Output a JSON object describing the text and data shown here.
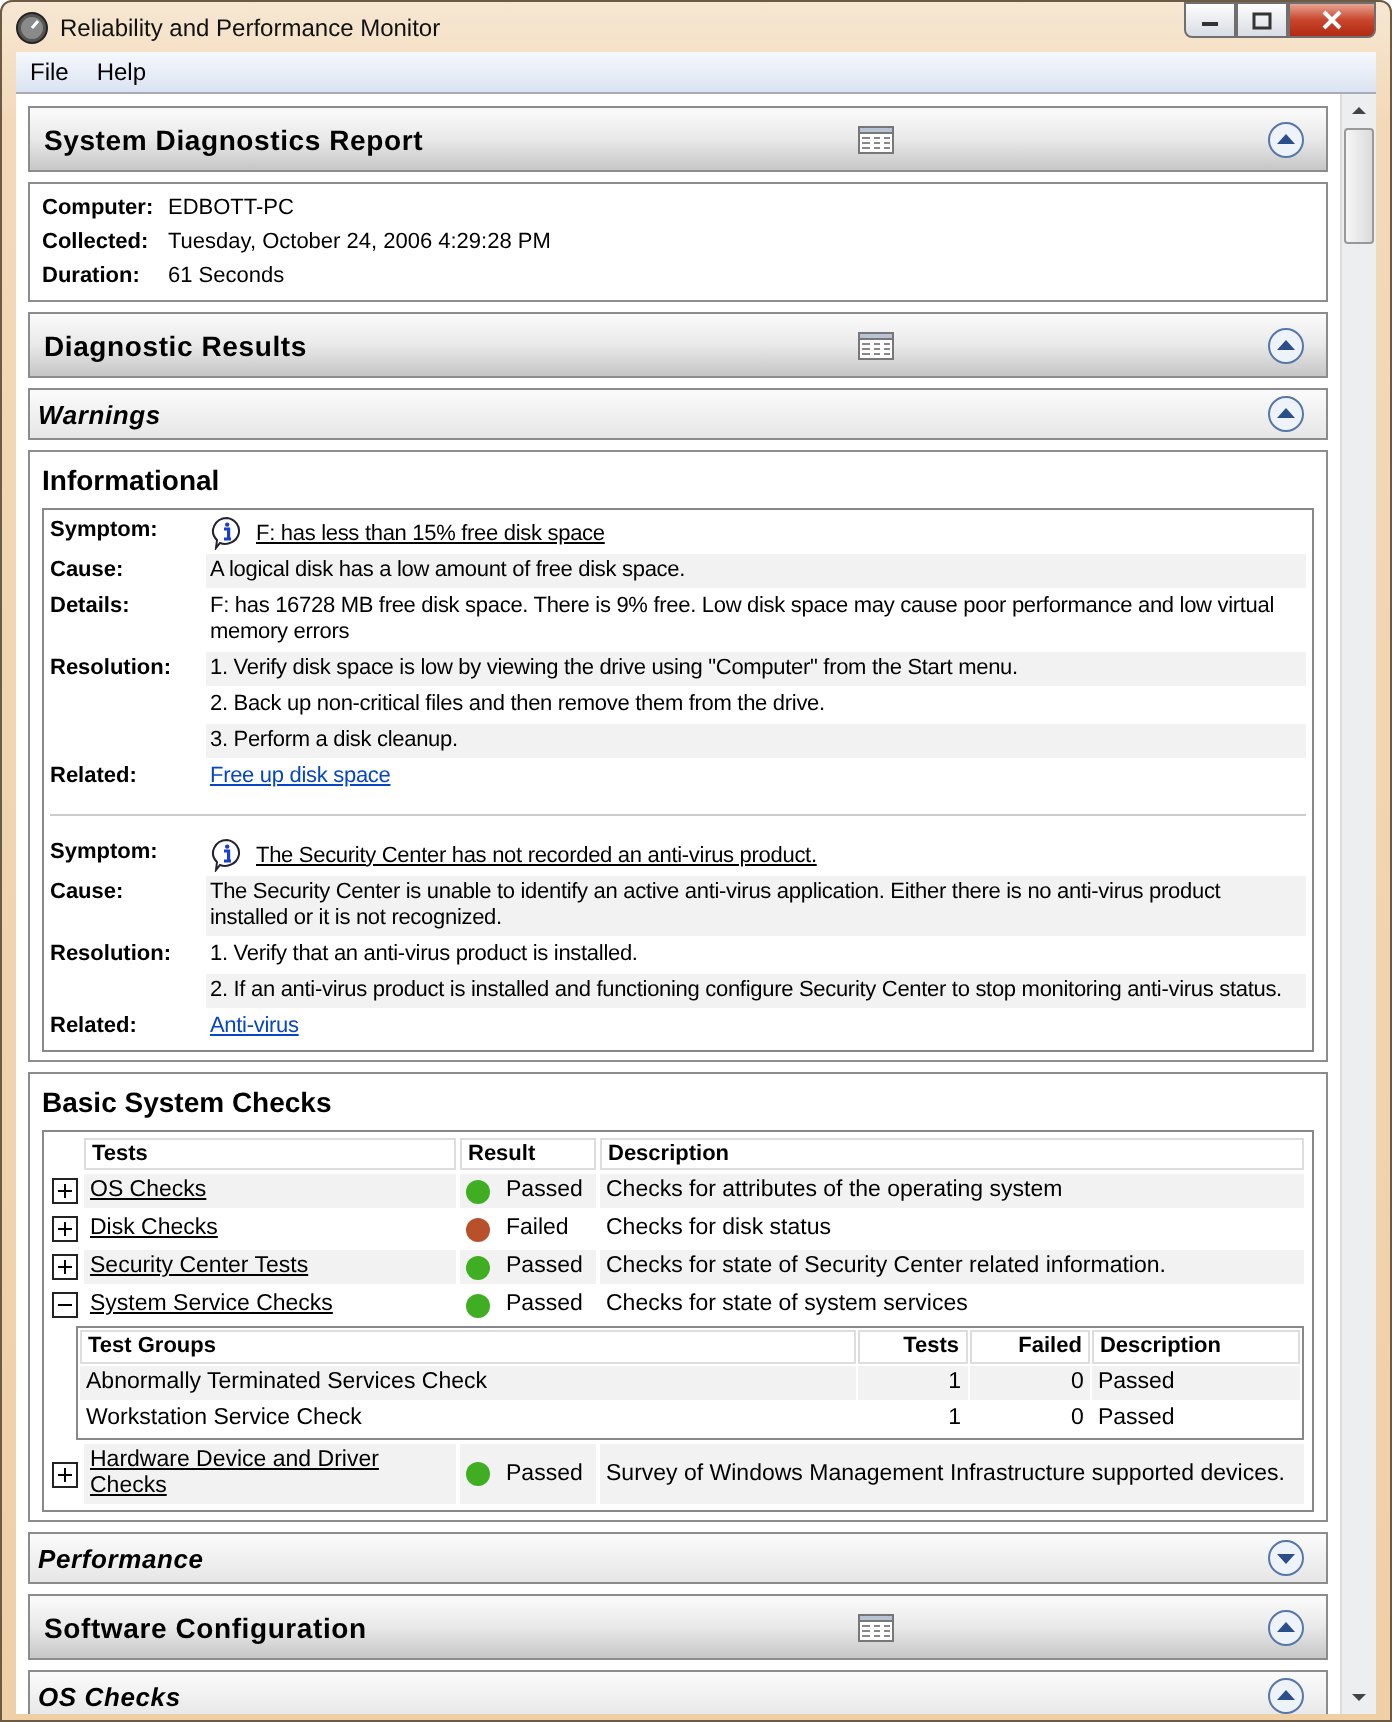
{
  "window": {
    "title": "Reliability and Performance Monitor"
  },
  "menu": [
    "File",
    "Help"
  ],
  "sections": [
    {
      "kind": "header",
      "title": "System Diagnostics Report",
      "expanded": true
    },
    {
      "kind": "fields",
      "fields": [
        {
          "label": "Computer:",
          "value": "EDBOTT-PC"
        },
        {
          "label": "Collected:",
          "value": "Tuesday, October 24, 2006 4:29:28 PM"
        },
        {
          "label": "Duration:",
          "value": "61 Seconds"
        }
      ]
    },
    {
      "kind": "header",
      "title": "Diagnostic Results",
      "expanded": true
    },
    {
      "kind": "subheader",
      "title": "Warnings",
      "expanded": true
    },
    {
      "kind": "issues",
      "title": "Informational",
      "issues": [
        {
          "rows": [
            {
              "label": "Symptom:",
              "kind": "symptom",
              "lines": [
                "F: has less than 15% free disk space"
              ]
            },
            {
              "label": "Cause:",
              "kind": "text",
              "lines": [
                "A logical disk has a low amount of free disk space."
              ]
            },
            {
              "label": "Details:",
              "kind": "text",
              "lines": [
                "F: has 16728 MB free disk space. There is 9% free. Low disk space may cause poor performance and low virtual memory errors"
              ]
            },
            {
              "label": "Resolution:",
              "kind": "text",
              "lines": [
                "1. Verify disk space is low by viewing the drive using \"Computer\" from the Start menu.",
                "2. Back up non-critical files and then remove them from the drive.",
                "3. Perform a disk cleanup."
              ]
            },
            {
              "label": "Related:",
              "kind": "link",
              "lines": [
                "Free up disk space"
              ]
            }
          ]
        },
        {
          "rows": [
            {
              "label": "Symptom:",
              "kind": "symptom",
              "lines": [
                "The Security Center has not recorded an anti-virus product."
              ]
            },
            {
              "label": "Cause:",
              "kind": "text",
              "lines": [
                "The Security Center is unable to identify an active anti-virus application. Either there is no anti-virus product installed or it is not recognized."
              ]
            },
            {
              "label": "Resolution:",
              "kind": "text",
              "lines": [
                "1. Verify that an anti-virus product is installed.",
                "2. If an anti-virus product is installed and functioning configure Security Center to stop monitoring anti-virus status."
              ]
            },
            {
              "label": "Related:",
              "kind": "link",
              "lines": [
                "Anti-virus"
              ]
            }
          ]
        }
      ]
    },
    {
      "kind": "checks",
      "title": "Basic System Checks",
      "columns": [
        "Tests",
        "Result",
        "Description"
      ],
      "rows": [
        {
          "name": "OS Checks",
          "expanded": false,
          "result": "Passed",
          "color": "#3fae22",
          "description": "Checks for attributes of the operating system"
        },
        {
          "name": "Disk Checks",
          "expanded": false,
          "result": "Failed",
          "color": "#b8502a",
          "description": "Checks for disk status"
        },
        {
          "name": "Security Center Tests",
          "expanded": false,
          "result": "Passed",
          "color": "#3fae22",
          "description": "Checks for state of Security Center related information."
        },
        {
          "name": "System Service Checks",
          "expanded": true,
          "result": "Passed",
          "color": "#3fae22",
          "description": "Checks for state of system services",
          "groups": {
            "columns": [
              "Test Groups",
              "Tests",
              "Failed",
              "Description"
            ],
            "rows": [
              [
                "Abnormally Terminated Services Check",
                "1",
                "0",
                "Passed"
              ],
              [
                "Workstation Service Check",
                "1",
                "0",
                "Passed"
              ]
            ]
          }
        },
        {
          "name": "Hardware Device and Driver Checks",
          "expanded": false,
          "result": "Passed",
          "color": "#3fae22",
          "description": "Survey of Windows Management Infrastructure supported devices."
        }
      ]
    },
    {
      "kind": "subheader",
      "title": "Performance",
      "expanded": false
    },
    {
      "kind": "header",
      "title": "Software Configuration",
      "expanded": true
    },
    {
      "kind": "subheader",
      "title": "OS Checks",
      "expanded": true
    }
  ]
}
